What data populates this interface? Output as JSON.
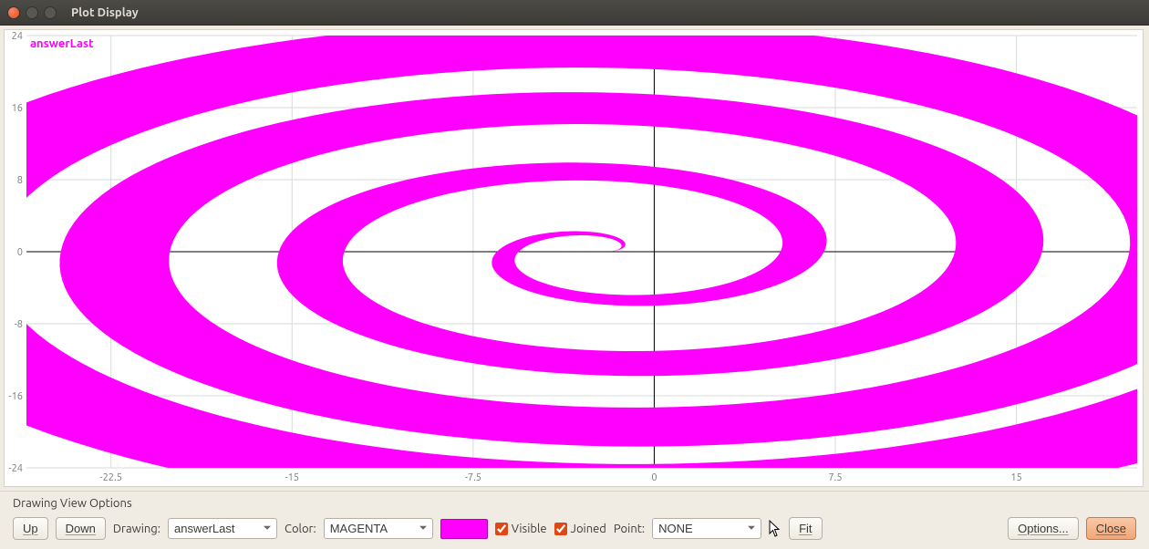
{
  "window": {
    "title": "Plot Display"
  },
  "chart_data": {
    "type": "line",
    "title": "",
    "series_name": "answerLast",
    "color": "#ff00ff",
    "xlabel": "",
    "ylabel": "",
    "x_ticks": [
      -22.5,
      -15,
      -7.5,
      0,
      7.5,
      15
    ],
    "y_ticks": [
      -24,
      -16,
      -8,
      0,
      8,
      16,
      24
    ],
    "xlim": [
      -26,
      20
    ],
    "ylim": [
      -24,
      24
    ],
    "description": "parametric spiral ribbon growing outward from origin, magenta filled bands",
    "parametric": {
      "t_min": 0,
      "t_max": 25.13,
      "inner_scale": 1.0,
      "outer_scale": 1.25,
      "x_center": -2
    }
  },
  "options": {
    "panel_title": "Drawing View Options",
    "up_button": "Up",
    "down_button": "Down",
    "drawing_label": "Drawing:",
    "drawing_value": "answerLast",
    "color_label": "Color:",
    "color_value": "MAGENTA",
    "swatch_hex": "#ff00ff",
    "visible_label": "Visible",
    "visible_checked": true,
    "joined_label": "Joined",
    "joined_checked": true,
    "point_label": "Point:",
    "point_value": "NONE",
    "fit_button": "Fit",
    "options_button": "Options...",
    "close_button": "Close"
  }
}
